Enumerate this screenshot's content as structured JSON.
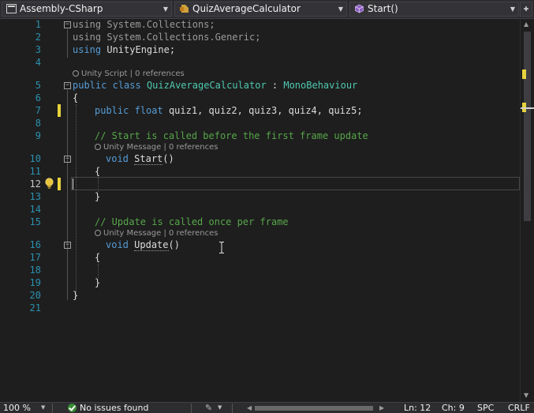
{
  "navbar": {
    "project": "Assembly-CSharp",
    "type": "QuizAverageCalculator",
    "member": "Start()",
    "project_icon": "csharp-project-icon",
    "type_icon": "class-icon",
    "member_icon": "method-cube-icon"
  },
  "editor": {
    "line_numbers": [
      "1",
      "2",
      "3",
      "4",
      "5",
      "6",
      "7",
      "8",
      "9",
      "10",
      "11",
      "12",
      "13",
      "14",
      "15",
      "16",
      "17",
      "18",
      "19",
      "20",
      "21"
    ],
    "code": {
      "l1_kw": "using",
      "l1_ns": " System.Collections;",
      "l2_kw": "using",
      "l2_ns": " System.Collections.Generic;",
      "l3_kw": "using",
      "l3_ns": " UnityEngine;",
      "lens_class": "Unity Script | 0 references",
      "l5_kw1": "public",
      "l5_kw2": "class",
      "l5_name": "QuizAverageCalculator",
      "l5_colon": " : ",
      "l5_base": "MonoBehaviour",
      "l6": "{",
      "l7_kw1": "public",
      "l7_kw2": "float",
      "l7_rest": " quiz1, quiz2, quiz3, quiz4, quiz5;",
      "l9_comment": "// Start is called before the first frame update",
      "lens_start": "Unity Message | 0 references",
      "l10_kw": "void",
      "l10_name": "Start",
      "l10_paren": "()",
      "l11": "{",
      "l13": "}",
      "l15_comment": "// Update is called once per frame",
      "lens_update": "Unity Message | 0 references",
      "l16_kw": "void",
      "l16_name": "Update",
      "l16_paren": "()",
      "l17": "{",
      "l19": "}",
      "l20": "}"
    },
    "colors": {
      "keyword": "#569cd6",
      "type": "#4ec9b0",
      "comment": "#57a64a",
      "line_number": "#2b91af",
      "change_marker": "#e8d33c"
    }
  },
  "status": {
    "zoom": "100 %",
    "issues": "No issues found",
    "line": "Ln: 12",
    "column": "Ch: 9",
    "whitespace": "SPC",
    "line_ending": "CRLF"
  }
}
